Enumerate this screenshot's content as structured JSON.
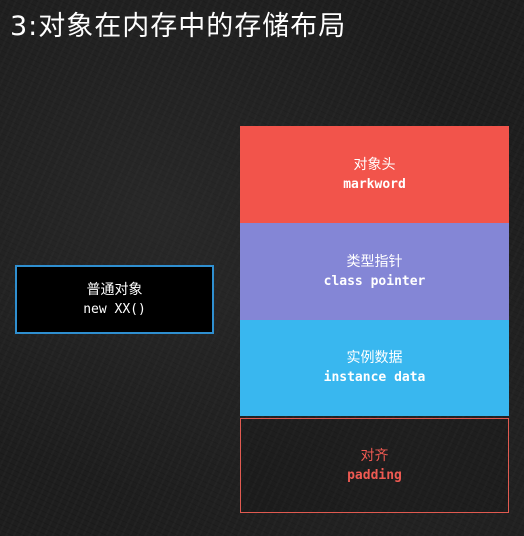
{
  "title": "3:对象在内存中的存储布局",
  "plain_object": {
    "label_cn": "普通对象",
    "label_code": "new XX()"
  },
  "layout_blocks": [
    {
      "label_cn": "对象头",
      "label_en": "markword",
      "color": "#f2544b"
    },
    {
      "label_cn": "类型指针",
      "label_en": "class pointer",
      "color": "#8486d6"
    },
    {
      "label_cn": "实例数据",
      "label_en": "instance data",
      "color": "#39b7ef"
    },
    {
      "label_cn": "对齐",
      "label_en": "padding",
      "color": "#ef5a52"
    }
  ],
  "colors": {
    "background": "#1e1e1e",
    "plain_object_border": "#2f8fd0"
  }
}
